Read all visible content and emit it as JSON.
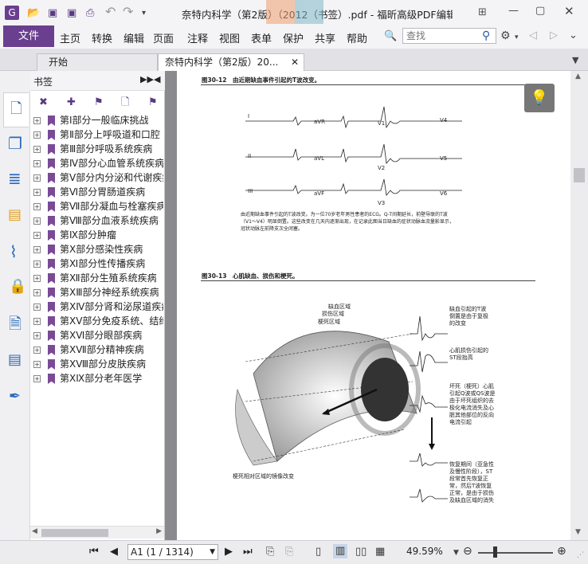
{
  "window": {
    "title": "奈特内科学（第2版）（2012（书签）.pdf - 福昕高级PDF编辑器"
  },
  "menu": {
    "file": "文件",
    "items": [
      "主页",
      "转换",
      "编辑",
      "页面",
      "注释",
      "视图",
      "表单",
      "保护",
      "共享",
      "帮助"
    ]
  },
  "search": {
    "placeholder": "查找"
  },
  "tabs": [
    {
      "label": "开始"
    },
    {
      "label": "奈特内科学（第2版）20..."
    }
  ],
  "bookmarks": {
    "title": "书签",
    "items": [
      "第Ⅰ部分一般临床挑战",
      "第Ⅱ部分上呼吸道和口腔",
      "第Ⅲ部分呼吸系统疾病",
      "第Ⅳ部分心血管系统疾病",
      "第Ⅴ部分内分泌和代谢疾病",
      "第Ⅵ部分胃肠道疾病",
      "第Ⅶ部分凝血与栓塞疾病",
      "第Ⅷ部分血液系统疾病",
      "第Ⅸ部分肿瘤",
      "第Ⅹ部分感染性疾病",
      "第Ⅺ部分性传播疾病",
      "第Ⅻ部分生殖系统疾病",
      "第ⅩⅢ部分神经系统疾病",
      "第ⅩⅣ部分肾和泌尿道疾病",
      "第ⅩⅤ部分免疫系统、结缔组织",
      "第ⅩⅥ部分眼部疾病",
      "第ⅩⅦ部分精神疾病",
      "第ⅩⅧ部分皮肤疾病",
      "第ⅩⅨ部分老年医学"
    ]
  },
  "document": {
    "fig12_caption": "图30-12　由近期缺血事件引起的T波改变。",
    "ecg_leads": [
      "I",
      "aVR",
      "V1",
      "V4",
      "II",
      "aVL",
      "V2",
      "V5",
      "III",
      "aVF",
      "V3",
      "V6"
    ],
    "fig12_note": "由近期缺血事件引起的T波改变。为一位70岁老年男性患者的ECG。Q-T间期延长，前壁导联的T波（V1～V4）明显倒置。这些改变在几天内逐渐出现，在记录此图当日缺血的症状动脉血流量影显示，冠状动脉左前降支次全闭塞。",
    "fig13_caption": "图30-13　心肌缺血、损伤和梗死。",
    "labels": {
      "ischemia": "缺血区域",
      "injury": "损伤区域",
      "infarct": "梗死区域",
      "mirror": "梗死相对区域的镜像改变"
    },
    "right_notes": [
      "缺血引起的T波倒置是由于复极的改变",
      "心肌损伤引起的ST段抬高",
      "坏死（梗死）心肌引起Q波或QS波是由于坏死组织的去极化电流消失及心脏其他部位的反向电流引起",
      "恢复期间（亚急性及慢性阶段），ST段常首先恢复正常，然后T波恢复正常，是由于损伤及缺血区域的消失"
    ]
  },
  "status": {
    "page_display": "A1 (1 / 1314)",
    "zoom": "49.59%"
  }
}
